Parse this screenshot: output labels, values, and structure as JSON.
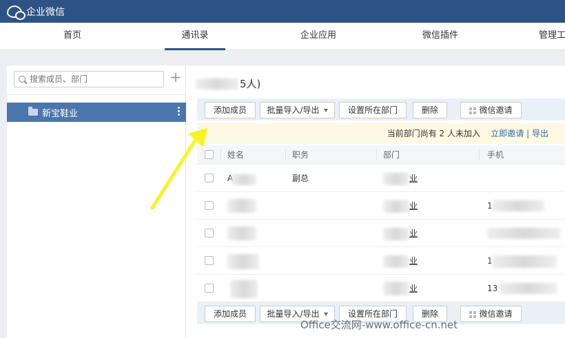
{
  "app": {
    "title": "企业微信"
  },
  "nav": {
    "tabs": [
      "首页",
      "通讯录",
      "企业应用",
      "微信插件",
      "管理工"
    ]
  },
  "sidebar": {
    "search_placeholder": "搜索成员、部门",
    "add_symbol": "+",
    "department": "新宝鞋业"
  },
  "main": {
    "title_suffix": "5人)",
    "toolbar": {
      "add_member": "添加成员",
      "import_export": "批量导入/导出",
      "set_department": "设置所在部门",
      "delete": "删除",
      "wechat_invite": "微信邀请"
    },
    "notice": {
      "text": "当前部门尚有 2 人未加入",
      "invite": "立即邀请",
      "separator": "|",
      "export": "导出"
    },
    "table": {
      "headers": [
        "姓名",
        "职务",
        "部门",
        "手机"
      ],
      "rows": [
        {
          "name": "A",
          "title": "副总",
          "dept_suffix": "业",
          "phone": ""
        },
        {
          "name": "",
          "title": "",
          "dept_suffix": "业",
          "phone": "1"
        },
        {
          "name": "",
          "title": "",
          "dept_suffix": "业",
          "phone": ""
        },
        {
          "name": "",
          "title": "",
          "dept_suffix": "业",
          "phone": "1"
        },
        {
          "name": "",
          "title": "",
          "dept_suffix": "业",
          "phone": "13"
        }
      ]
    }
  },
  "watermark": "Office交流网-www.office-cn.net",
  "colors": {
    "topbar": "#2d5385",
    "selected_dept": "#4a75ad",
    "link": "#2d6cb3",
    "arrow": "#f5f523"
  }
}
